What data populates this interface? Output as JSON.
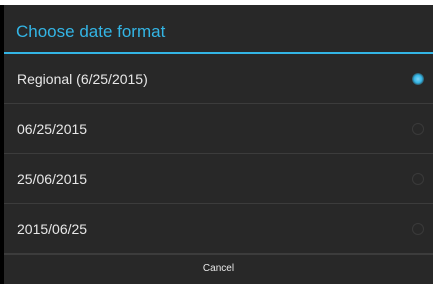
{
  "dialog": {
    "title": "Choose date format",
    "accent_color": "#33b5e5",
    "options": [
      {
        "label": "Regional (6/25/2015)",
        "selected": true
      },
      {
        "label": "06/25/2015",
        "selected": false
      },
      {
        "label": "25/06/2015",
        "selected": false
      },
      {
        "label": "2015/06/25",
        "selected": false
      }
    ],
    "cancel_label": "Cancel"
  }
}
